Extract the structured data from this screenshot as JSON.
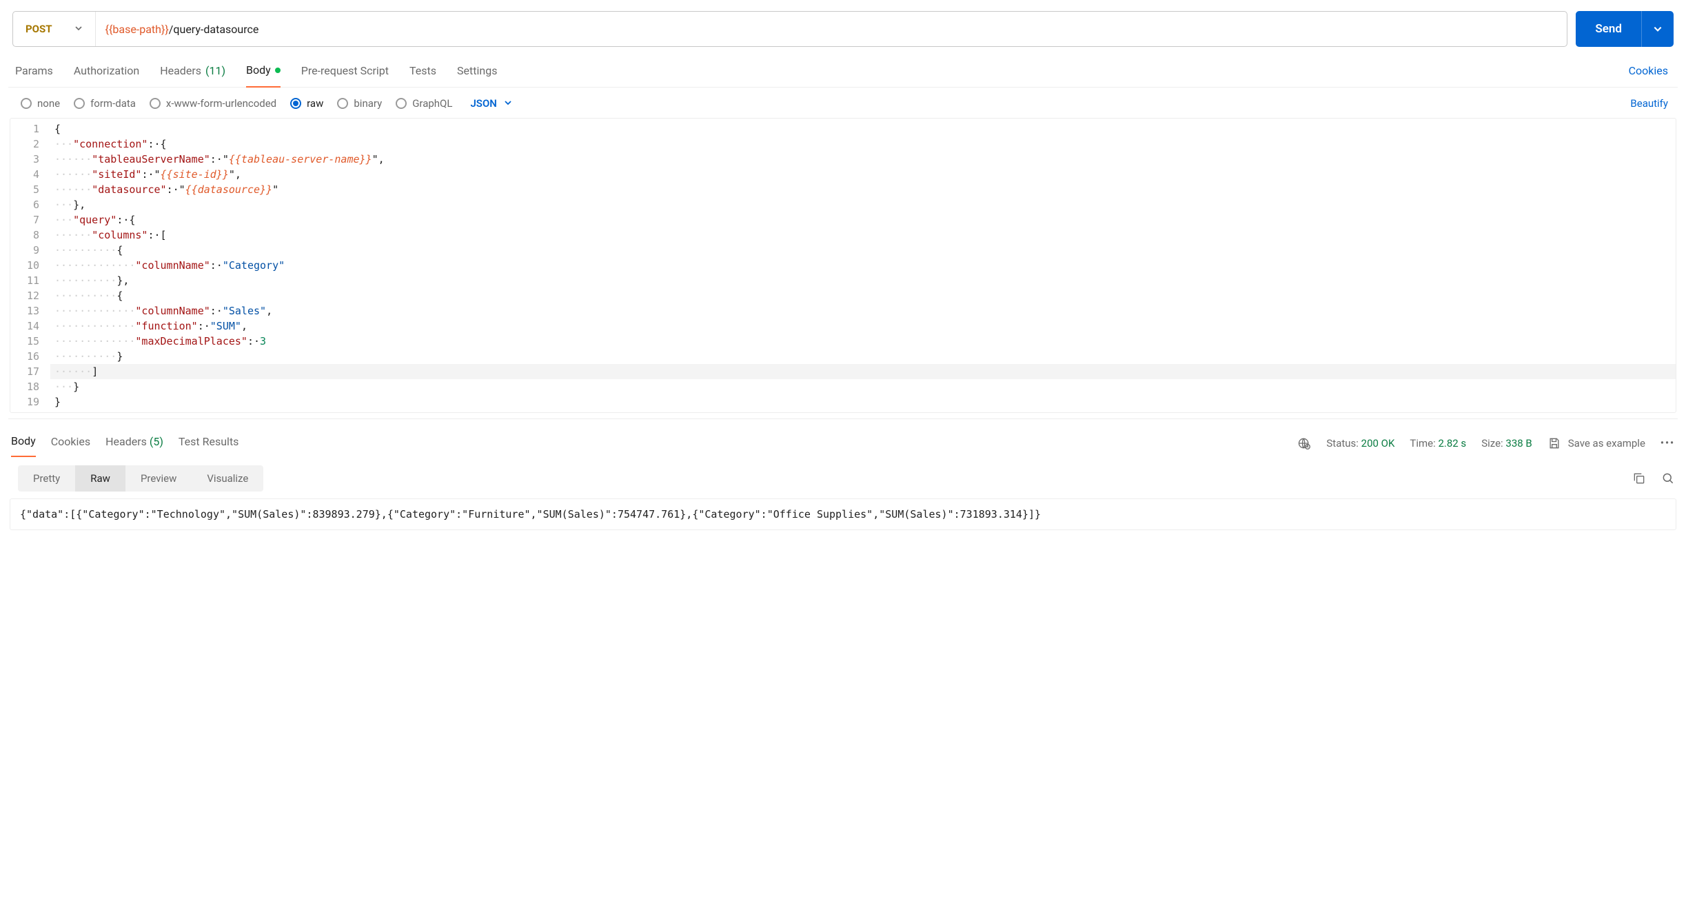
{
  "request": {
    "method": "POST",
    "url_var": "{{base-path}}",
    "url_path": "/query-datasource",
    "send_label": "Send"
  },
  "request_tabs": {
    "params": "Params",
    "authorization": "Authorization",
    "headers": "Headers",
    "headers_count": "(11)",
    "body": "Body",
    "prerequest": "Pre-request Script",
    "tests": "Tests",
    "settings": "Settings",
    "cookies": "Cookies"
  },
  "body_types": {
    "none": "none",
    "formdata": "form-data",
    "urlencoded": "x-www-form-urlencoded",
    "raw": "raw",
    "binary": "binary",
    "graphql": "GraphQL",
    "json": "JSON",
    "beautify": "Beautify"
  },
  "editor_lines": [
    [
      [
        "pun",
        "{"
      ]
    ],
    [
      [
        "ws",
        "···"
      ],
      [
        "key",
        "\"connection\""
      ],
      [
        "pun",
        ":·{"
      ]
    ],
    [
      [
        "ws",
        "······"
      ],
      [
        "key",
        "\"tableauServerName\""
      ],
      [
        "pun",
        ":·"
      ],
      [
        "pun",
        "\""
      ],
      [
        "var",
        "{{tableau-server-name}}"
      ],
      [
        "pun",
        "\","
      ]
    ],
    [
      [
        "ws",
        "······"
      ],
      [
        "key",
        "\"siteId\""
      ],
      [
        "pun",
        ":·"
      ],
      [
        "pun",
        "\""
      ],
      [
        "var",
        "{{site-id}}"
      ],
      [
        "pun",
        "\","
      ]
    ],
    [
      [
        "ws",
        "······"
      ],
      [
        "key",
        "\"datasource\""
      ],
      [
        "pun",
        ":·"
      ],
      [
        "pun",
        "\""
      ],
      [
        "var",
        "{{datasource}}"
      ],
      [
        "pun",
        "\""
      ]
    ],
    [
      [
        "ws",
        "···"
      ],
      [
        "pun",
        "},"
      ]
    ],
    [
      [
        "ws",
        "···"
      ],
      [
        "key",
        "\"query\""
      ],
      [
        "pun",
        ":·{"
      ]
    ],
    [
      [
        "ws",
        "······"
      ],
      [
        "key",
        "\"columns\""
      ],
      [
        "pun",
        ":·["
      ]
    ],
    [
      [
        "ws",
        "··········"
      ],
      [
        "pun",
        "{"
      ]
    ],
    [
      [
        "ws",
        "·············"
      ],
      [
        "key",
        "\"columnName\""
      ],
      [
        "pun",
        ":·"
      ],
      [
        "str",
        "\"Category\""
      ]
    ],
    [
      [
        "ws",
        "··········"
      ],
      [
        "pun",
        "},"
      ]
    ],
    [
      [
        "ws",
        "··········"
      ],
      [
        "pun",
        "{"
      ]
    ],
    [
      [
        "ws",
        "·············"
      ],
      [
        "key",
        "\"columnName\""
      ],
      [
        "pun",
        ":·"
      ],
      [
        "str",
        "\"Sales\""
      ],
      [
        "pun",
        ","
      ]
    ],
    [
      [
        "ws",
        "·············"
      ],
      [
        "key",
        "\"function\""
      ],
      [
        "pun",
        ":·"
      ],
      [
        "str",
        "\"SUM\""
      ],
      [
        "pun",
        ","
      ]
    ],
    [
      [
        "ws",
        "·············"
      ],
      [
        "key",
        "\"maxDecimalPlaces\""
      ],
      [
        "pun",
        ":·"
      ],
      [
        "num",
        "3"
      ]
    ],
    [
      [
        "ws",
        "··········"
      ],
      [
        "pun",
        "}"
      ]
    ],
    [
      [
        "ws",
        "······"
      ],
      [
        "pun",
        "]"
      ]
    ],
    [
      [
        "ws",
        "···"
      ],
      [
        "pun",
        "}"
      ]
    ],
    [
      [
        "pun",
        "}"
      ]
    ]
  ],
  "response_tabs": {
    "body": "Body",
    "cookies": "Cookies",
    "headers": "Headers",
    "headers_count": "(5)",
    "test_results": "Test Results"
  },
  "status": {
    "status_label": "Status:",
    "status_value": "200 OK",
    "time_label": "Time:",
    "time_value": "2.82 s",
    "size_label": "Size:",
    "size_value": "338 B",
    "save_example": "Save as example"
  },
  "view_modes": {
    "pretty": "Pretty",
    "raw": "Raw",
    "preview": "Preview",
    "visualize": "Visualize"
  },
  "response_body": "{\"data\":[{\"Category\":\"Technology\",\"SUM(Sales)\":839893.279},{\"Category\":\"Furniture\",\"SUM(Sales)\":754747.761},{\"Category\":\"Office Supplies\",\"SUM(Sales)\":731893.314}]}"
}
